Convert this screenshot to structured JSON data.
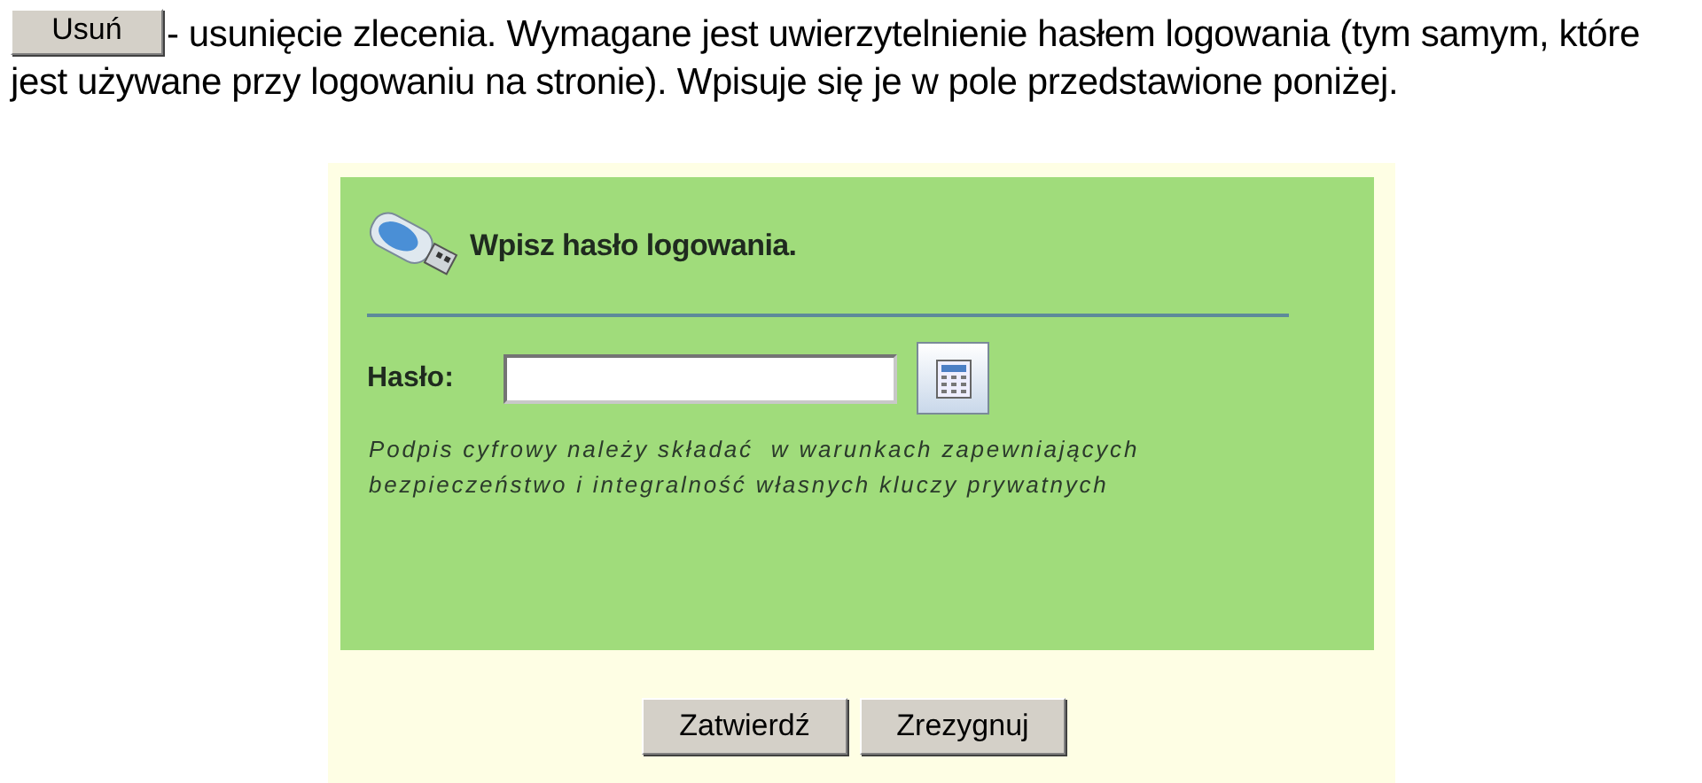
{
  "intro": {
    "button": "Usuń",
    "line_1": " - usunięcie zlecenia. Wymagane jest uwierzytelnienie hasłem logowania (tym samym, które",
    "line_2": "jest używane przy logowaniu na stronie). Wpisuje się je w pole przedstawione poniżej."
  },
  "dialog": {
    "heading": "Wpisz hasło logowania.",
    "password_label": "Hasło:",
    "note": "Podpis cyfrowy należy składać  w warunkach zapewniających bezpieczeństwo i integralność własnych kluczy prywatnych",
    "buttons": [
      "Zatwierdź",
      "Zrezygnuj"
    ]
  }
}
